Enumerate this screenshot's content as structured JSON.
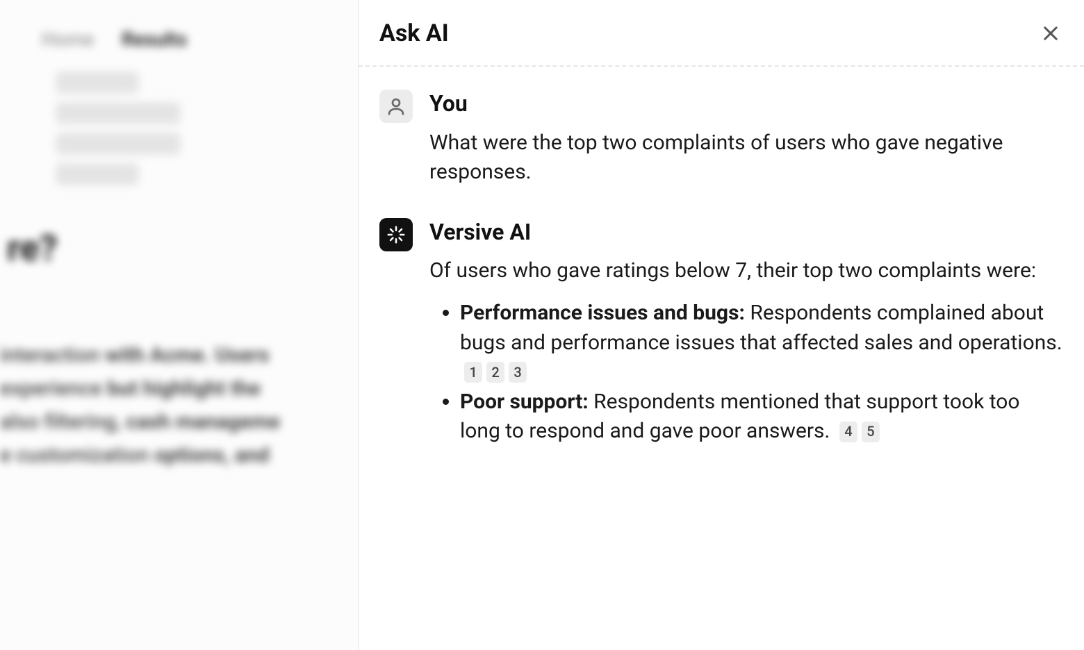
{
  "background": {
    "tab_inactive": "Home",
    "tab_active": "Results",
    "title_fragment": "re?",
    "line1_pre": "interaction ",
    "line1_bold": "with Acme. Users",
    "line2_pre": "experience ",
    "line2_bold": "but highlight the",
    "line3_pre": "also filtering, ",
    "line3_bold": "cash manageme",
    "line4_pre": "e customization ",
    "line4_bold": "options, and"
  },
  "panel": {
    "title": "Ask AI"
  },
  "conversation": {
    "user": {
      "name": "You",
      "message": "What were the top two complaints of users who gave negative responses."
    },
    "ai": {
      "name": "Versive AI",
      "intro": "Of users who gave ratings below 7, their top two complaints were:",
      "bullets": [
        {
          "bold": "Performance issues and bugs:",
          "text": " Respondents complained about bugs and performance issues that affected sales and operations.",
          "cites": [
            "1",
            "2",
            "3"
          ]
        },
        {
          "bold": "Poor support:",
          "text": " Respondents mentioned that support took too long to respond and gave poor answers.",
          "cites": [
            "4",
            "5"
          ]
        }
      ]
    }
  }
}
